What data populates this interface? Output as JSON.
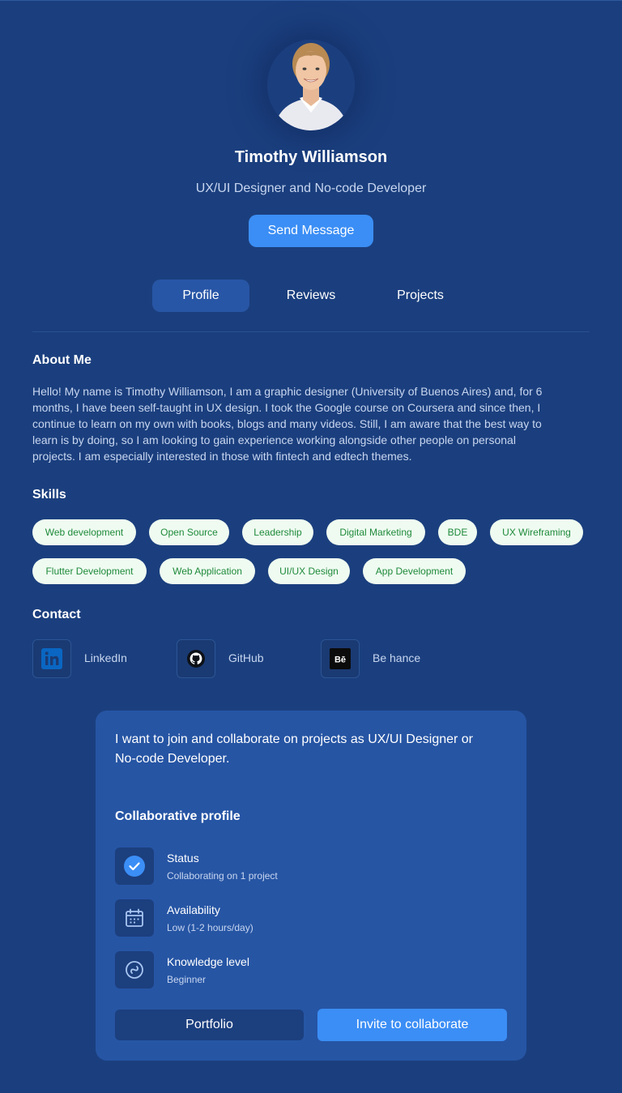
{
  "profile": {
    "name": "Timothy Williamson",
    "role": "UX/UI Designer and No-code Developer",
    "send_message_label": "Send Message"
  },
  "tabs": [
    {
      "label": "Profile",
      "active": true
    },
    {
      "label": "Reviews",
      "active": false
    },
    {
      "label": "Projects",
      "active": false
    }
  ],
  "about": {
    "title": "About Me",
    "lines": [
      "Hello! My name is Timothy Williamson, I am a graphic designer (University of Buenos Aires) and, for 6",
      "months, I have been self-taught in UX design. I took the Google course on Coursera and since then, I",
      "continue to learn on my own with books, blogs and many videos. Still, I am aware that the best way to",
      "learn is by doing, so I am looking to gain experience working alongside other people on personal",
      "projects. I am especially interested in those with fintech and edtech themes."
    ]
  },
  "skills": {
    "title": "Skills",
    "items": [
      "Web development",
      "Open Source",
      "Leadership",
      "Digital Marketing",
      "BDE",
      "UX Wireframing",
      "Flutter Development",
      "Web Application",
      "UI/UX Design",
      "App Development"
    ]
  },
  "contact": {
    "title": "Contact",
    "items": [
      {
        "label": "LinkedIn",
        "icon": "linkedin-icon"
      },
      {
        "label": "GitHub",
        "icon": "github-icon"
      },
      {
        "label": "Be hance",
        "icon": "behance-icon"
      }
    ]
  },
  "collab": {
    "intro_lines": [
      "I want to join and collaborate on projects  as UX/UI Designer or",
      "No-code Developer."
    ],
    "title": "Collaborative profile",
    "items": [
      {
        "title": "Status",
        "value": "Collaborating on 1 project",
        "icon": "check-circle-icon"
      },
      {
        "title": "Availability",
        "value": "Low (1-2 hours/day)",
        "icon": "calendar-icon"
      },
      {
        "title": "Knowledge level",
        "value": "Beginner",
        "icon": "level-icon"
      }
    ],
    "portfolio_label": "Portfolio",
    "invite_label": "Invite to collaborate"
  },
  "colors": {
    "background": "#1b3f7e",
    "card": "#2655a4",
    "accent": "#3b8ef5",
    "chip_bg": "#effbf1",
    "chip_text": "#1f8a3b"
  }
}
